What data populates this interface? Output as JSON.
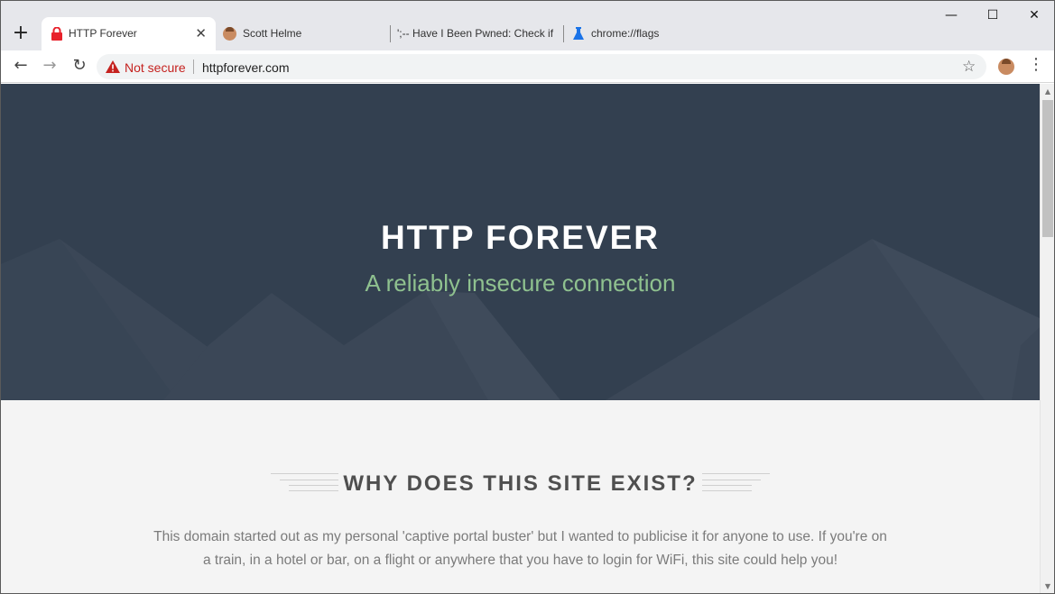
{
  "browser": {
    "tabs": [
      {
        "title": "HTTP Forever",
        "icon": "lock-icon",
        "active": true
      },
      {
        "title": "Scott Helme",
        "icon": "avatar-icon",
        "active": false
      },
      {
        "title": "';-- Have I Been Pwned: Check if",
        "icon": "hibp-icon",
        "active": false
      },
      {
        "title": "chrome://flags",
        "icon": "flask-icon",
        "active": false
      }
    ],
    "close_glyph": "✕",
    "new_tab_glyph": "+",
    "window_controls": {
      "minimize": "—",
      "maximize": "☐",
      "close": "✕"
    }
  },
  "toolbar": {
    "back_glyph": "←",
    "forward_glyph": "→",
    "reload_glyph": "↻",
    "security_label": "Not secure",
    "url": "httpforever.com",
    "star_glyph": "☆",
    "menu_glyph": "⋮"
  },
  "page": {
    "hero_title": "HTTP FOREVER",
    "hero_subtitle": "A reliably insecure connection",
    "section_title": "WHY DOES THIS SITE EXIST?",
    "body_text": "This domain started out as my personal 'captive portal buster' but I wanted to publicise it for anyone to use. If you're on a train, in a hotel or bar, on a flight or anywhere that you have to login for WiFi, this site could help you!"
  },
  "colors": {
    "hero_bg": "#334050",
    "hero_subtitle": "#8fc18f",
    "not_secure": "#c5221f"
  },
  "scrollbar": {
    "up_glyph": "▲",
    "down_glyph": "▼"
  }
}
